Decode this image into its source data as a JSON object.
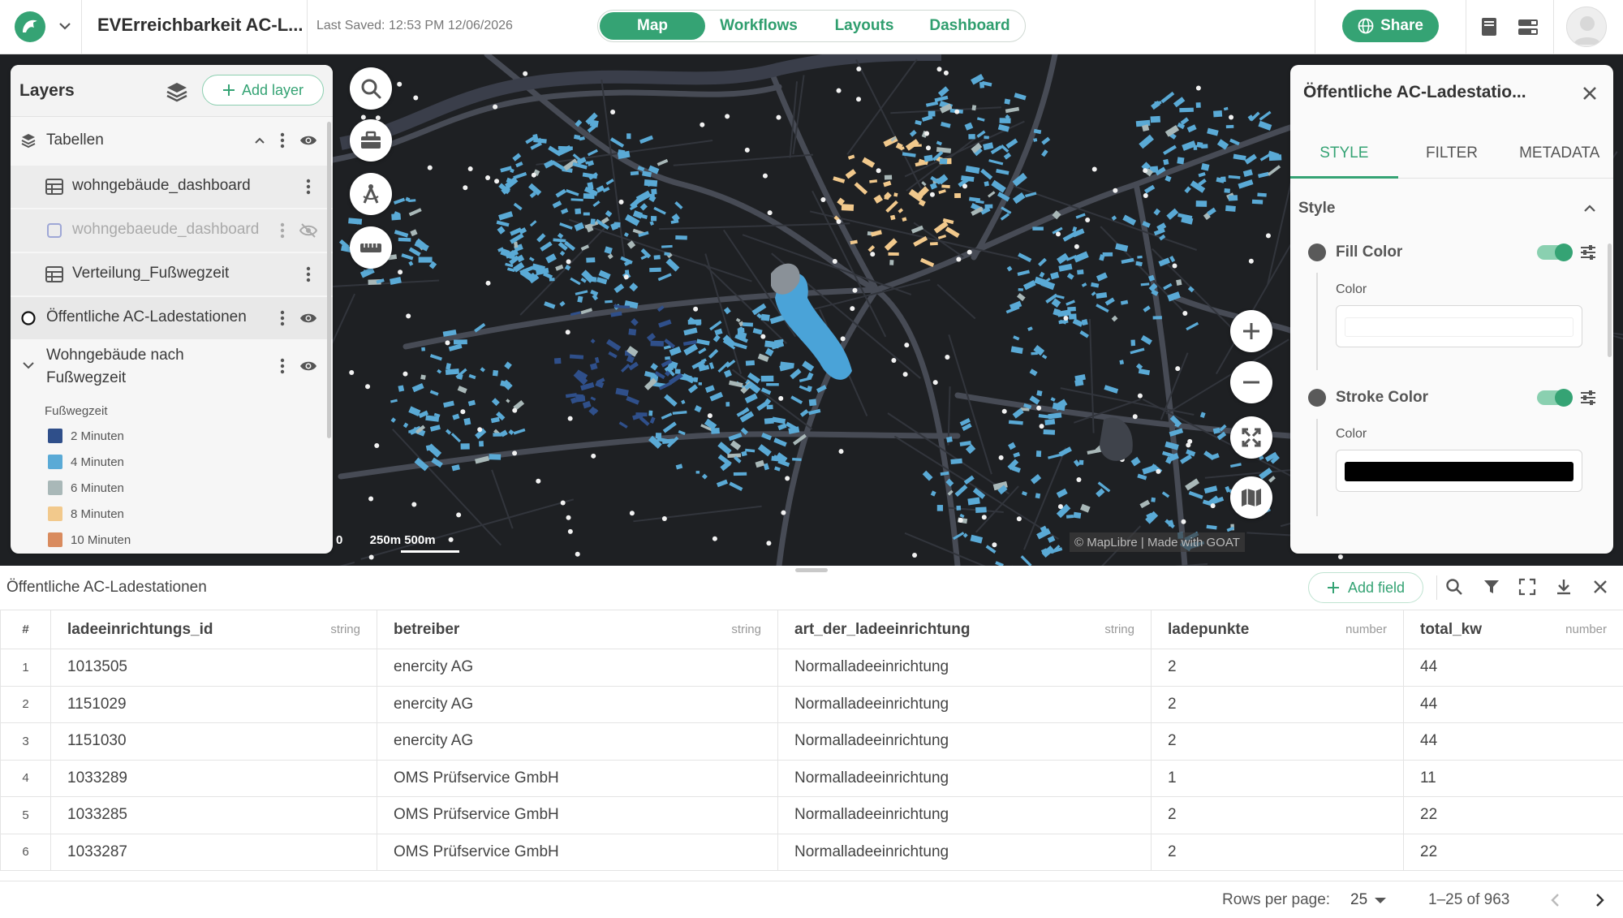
{
  "header": {
    "project_title": "EVErreichbarkeit AC-L...",
    "last_saved": "Last Saved: 12:53 PM 12/06/2026",
    "nav_tabs": [
      {
        "label": "Map",
        "active": true
      },
      {
        "label": "Workflows",
        "active": false
      },
      {
        "label": "Layouts",
        "active": false
      },
      {
        "label": "Dashboard",
        "active": false
      }
    ],
    "share_label": "Share",
    "accent_color": "#35a374"
  },
  "layers_panel": {
    "title": "Layers",
    "add_layer_label": "Add layer",
    "group": {
      "label": "Tabellen"
    },
    "rows": [
      {
        "label": "wohngebäude_dashboard",
        "visible": true
      },
      {
        "label": "wohngebaeude_dashboard",
        "visible": false
      },
      {
        "label": "Verteilung_Fußwegzeit",
        "visible": true
      },
      {
        "label": "Öffentliche AC-Ladestationen",
        "visible": true
      },
      {
        "label": "Wohngebäude nach Fußwegzeit",
        "visible": true
      }
    ],
    "legend": {
      "title": "Fußwegzeit",
      "items": [
        {
          "label": "2 Minuten",
          "color": "#2f4f8a"
        },
        {
          "label": "4 Minuten",
          "color": "#5aaad6"
        },
        {
          "label": "6 Minuten",
          "color": "#a9b8b8"
        },
        {
          "label": "8 Minuten",
          "color": "#f2c98c"
        },
        {
          "label": "10 Minuten",
          "color": "#d98b5e"
        }
      ]
    }
  },
  "map": {
    "scale_labels": "0        250m 500m",
    "attribution": "© MapLibre | Made with GOAT"
  },
  "properties_panel": {
    "title": "Öffentliche AC-Ladestatio...",
    "tabs": [
      {
        "label": "STYLE",
        "active": true
      },
      {
        "label": "FILTER",
        "active": false
      },
      {
        "label": "METADATA",
        "active": false
      }
    ],
    "section_title": "Style",
    "fill": {
      "label": "Fill Color",
      "color_label": "Color",
      "value": "#ffffff"
    },
    "stroke": {
      "label": "Stroke Color",
      "color_label": "Color",
      "value": "#000000"
    }
  },
  "table": {
    "title": "Öffentliche AC-Ladestationen",
    "add_field_label": "Add field",
    "index_header": "#",
    "columns": [
      {
        "name": "ladeeinrichtungs_id",
        "type": "string"
      },
      {
        "name": "betreiber",
        "type": "string"
      },
      {
        "name": "art_der_ladeeinrichtung",
        "type": "string"
      },
      {
        "name": "ladepunkte",
        "type": "number"
      },
      {
        "name": "total_kw",
        "type": "number"
      }
    ],
    "rows": [
      {
        "idx": "1",
        "cells": [
          "1013505",
          "enercity AG",
          "Normalladeeinrichtung",
          "2",
          "44"
        ]
      },
      {
        "idx": "2",
        "cells": [
          "1151029",
          "enercity AG",
          "Normalladeeinrichtung",
          "2",
          "44"
        ]
      },
      {
        "idx": "3",
        "cells": [
          "1151030",
          "enercity AG",
          "Normalladeeinrichtung",
          "2",
          "44"
        ]
      },
      {
        "idx": "4",
        "cells": [
          "1033289",
          "OMS Prüfservice GmbH",
          "Normalladeeinrichtung",
          "1",
          "11"
        ]
      },
      {
        "idx": "5",
        "cells": [
          "1033285",
          "OMS Prüfservice GmbH",
          "Normalladeeinrichtung",
          "2",
          "22"
        ]
      },
      {
        "idx": "6",
        "cells": [
          "1033287",
          "OMS Prüfservice GmbH",
          "Normalladeeinrichtung",
          "2",
          "22"
        ]
      }
    ],
    "footer": {
      "rows_per_page_label": "Rows per page:",
      "rows_per_page_value": "25",
      "range_label": "1–25 of 963"
    }
  }
}
